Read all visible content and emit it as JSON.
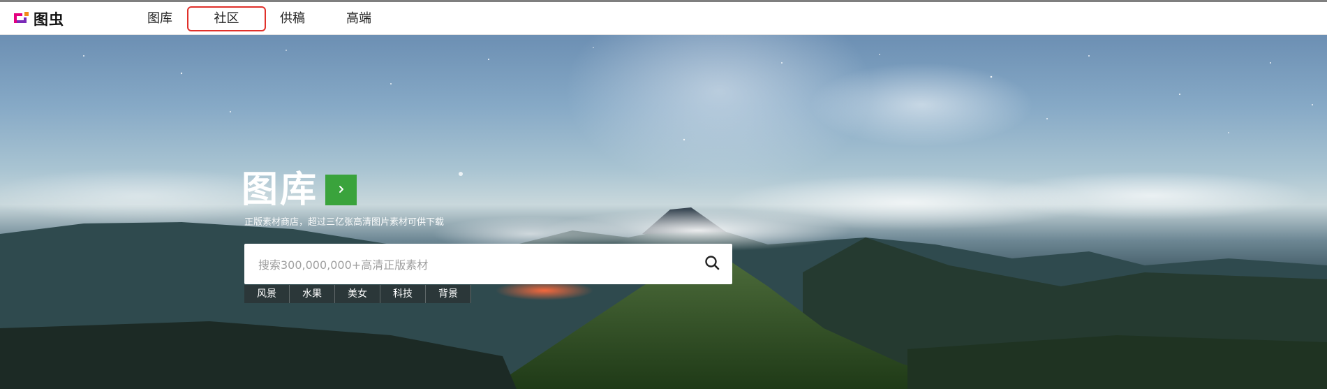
{
  "logo": {
    "text": "图虫",
    "icon": "tuchong-logo-icon"
  },
  "nav": {
    "items": [
      {
        "label": "图库"
      },
      {
        "label": "社区"
      },
      {
        "label": "供稿"
      },
      {
        "label": "高端"
      }
    ],
    "active": "社区"
  },
  "hero": {
    "title": "图库",
    "arrow_icon": "chevron-right-icon",
    "subtitle": "正版素材商店，超过三亿张高清图片素材可供下载",
    "search": {
      "placeholder": "搜索300,000,000+高清正版素材",
      "value": "",
      "icon": "search-icon"
    },
    "tags": [
      "风景",
      "水果",
      "美女",
      "科技",
      "背景"
    ]
  },
  "colors": {
    "accent_green": "#3aa33c",
    "active_outline": "#e0302a",
    "logo_orange": "#f28a18",
    "logo_magenta": "#e4007f"
  }
}
